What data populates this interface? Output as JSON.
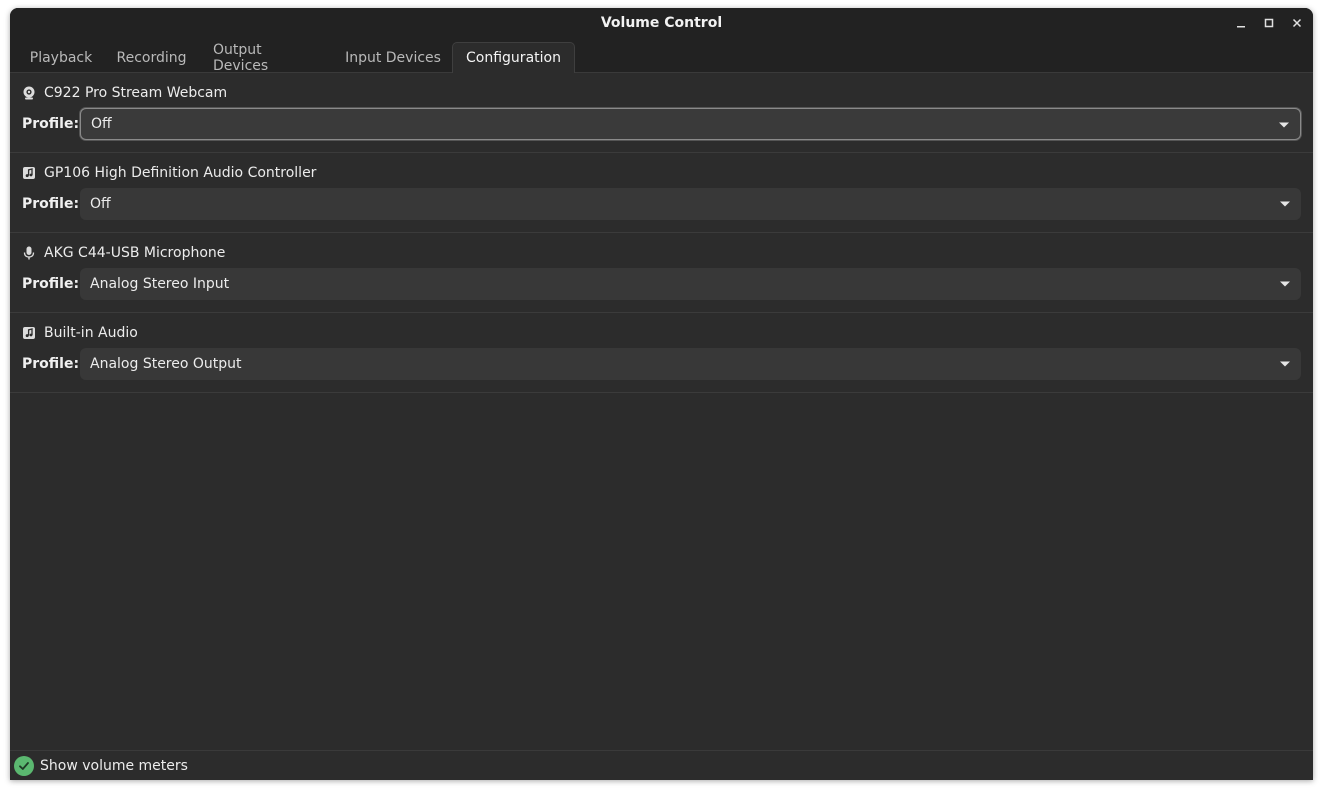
{
  "window": {
    "title": "Volume Control",
    "controls": [
      "minimize-icon",
      "maximize-icon",
      "close-icon"
    ]
  },
  "tabs": [
    {
      "label": "Playback",
      "active": false
    },
    {
      "label": "Recording",
      "active": false
    },
    {
      "label": "Output Devices",
      "active": false
    },
    {
      "label": "Input Devices",
      "active": false
    },
    {
      "label": "Configuration",
      "active": true
    }
  ],
  "devices": [
    {
      "name": "C922 Pro Stream Webcam",
      "icon": "webcam-icon",
      "profile_label": "Profile:",
      "profile": "Off"
    },
    {
      "name": "GP106 High Definition Audio Controller",
      "icon": "audio-card-icon",
      "profile_label": "Profile:",
      "profile": "Off"
    },
    {
      "name": "AKG C44-USB Microphone",
      "icon": "microphone-icon",
      "profile_label": "Profile:",
      "profile": "Analog Stereo Input"
    },
    {
      "name": "Built-in Audio",
      "icon": "audio-card-icon",
      "profile_label": "Profile:",
      "profile": "Analog Stereo Output"
    }
  ],
  "footer": {
    "show_meters_label": "Show volume meters",
    "show_meters_checked": true
  },
  "colors": {
    "window_bg": "#2c2c2c",
    "titlebar_bg": "#222222",
    "select_bg": "#383838",
    "check_green": "#5bb870"
  }
}
